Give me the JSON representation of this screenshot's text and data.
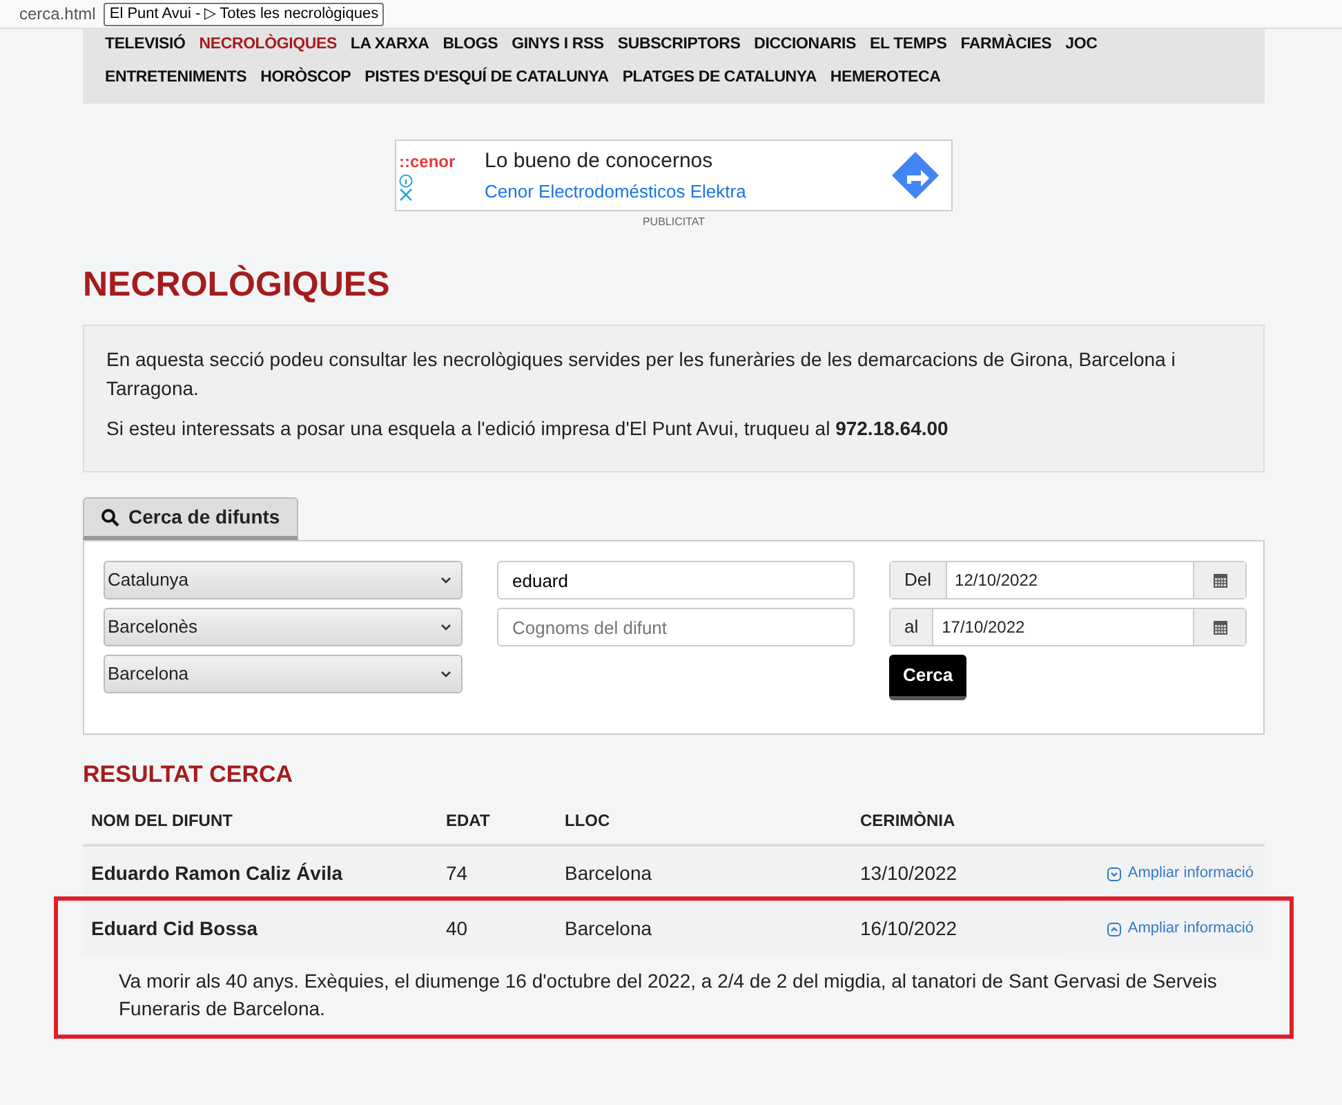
{
  "browser": {
    "tooltip": "El Punt Avui - ▷ Totes les necrològiques",
    "url": "cerca.html"
  },
  "nav": {
    "items": [
      {
        "label": "TELEVISIÓ",
        "selected": false
      },
      {
        "label": "NECROLÒGIQUES",
        "selected": true
      },
      {
        "label": "LA XARXA",
        "selected": false
      },
      {
        "label": "BLOGS",
        "selected": false
      },
      {
        "label": "GINYS I RSS",
        "selected": false
      },
      {
        "label": "SUBSCRIPTORS",
        "selected": false
      },
      {
        "label": "DICCIONARIS",
        "selected": false
      },
      {
        "label": "EL TEMPS",
        "selected": false
      },
      {
        "label": "FARMÀCIES",
        "selected": false
      },
      {
        "label": "JOC",
        "selected": false
      },
      {
        "label": "ENTRETENIMENTS",
        "selected": false
      },
      {
        "label": "HORÒSCOP",
        "selected": false
      },
      {
        "label": "PISTES D'ESQUÍ DE CATALUNYA",
        "selected": false
      },
      {
        "label": "PLATGES DE CATALUNYA",
        "selected": false
      },
      {
        "label": "HEMEROTECA",
        "selected": false
      }
    ]
  },
  "ad": {
    "logo": "::cenor",
    "headline": "Lo bueno de conocernos",
    "advertiser": "Cenor Electrodomésticos Elektra",
    "label": "PUBLICITAT"
  },
  "title": "NECROLÒGIQUES",
  "intro": [
    "En aquesta secció podeu consultar les necrològiques servides per les funeràries de les demarcacions de Girona, Barcelona i Tarragona.",
    "Si esteu interessats a posar una esquela a l'edició impresa d'El Punt Avui,  truqueu al **972.18.64.00**"
  ],
  "search": {
    "tab_label": "Cerca de difunts",
    "selects": [
      "Catalunya",
      "Barcelonès",
      "Barcelona"
    ],
    "name_value": "eduard",
    "surname_placeholder": "Cognoms del difunt",
    "date_from": {
      "label": "Del",
      "value": "12/10/2022"
    },
    "date_to": {
      "label": "al",
      "value": "17/10/2022"
    },
    "button": "Cerca"
  },
  "results": {
    "title": "RESULTAT CERCA",
    "columns": [
      "NOM DEL DIFUNT",
      "EDAT",
      "LLOC",
      "CERIMÒNIA"
    ],
    "rows": [
      {
        "name": "Eduardo Ramon Caliz Ávila",
        "age": "74",
        "place": "Barcelona",
        "date": "13/10/2022",
        "link": "Ampliar informació",
        "expanded": false,
        "highlighted": false
      },
      {
        "name": "Eduard Cid Bossa",
        "age": "40",
        "place": "Barcelona",
        "date": "16/10/2022",
        "link": "Ampliar informació",
        "expanded": true,
        "highlighted": true,
        "details": "Va morir als 40 anys. Exèquies, el diumenge 16 d'octubre del 2022, a 2/4 de 2 del migdia, al tanatori de Sant Gervasi de Serveis Funeraris de Barcelona."
      }
    ]
  }
}
